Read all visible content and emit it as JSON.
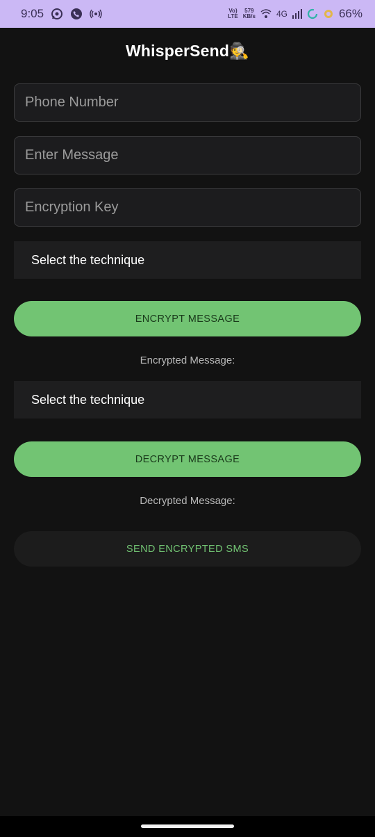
{
  "status_bar": {
    "time": "9:05",
    "network_type": "4G",
    "speed_value": "579",
    "speed_unit": "KB/s",
    "volte_top": "Vo)",
    "volte_bottom": "LTE",
    "battery_percent": "66%"
  },
  "app": {
    "title": "WhisperSend🕵️"
  },
  "form": {
    "phone_placeholder": "Phone Number",
    "message_placeholder": "Enter Message",
    "key_placeholder": "Encryption Key",
    "encrypt_technique": "Select the technique",
    "encrypt_button": "ENCRYPT MESSAGE",
    "encrypted_caption": "Encrypted Message:",
    "decrypt_technique": "Select the technique",
    "decrypt_button": "DECRYPT MESSAGE",
    "decrypted_caption": "Decrypted Message:",
    "send_button": "SEND ENCRYPTED SMS"
  },
  "colors": {
    "background": "#121212",
    "status_bar": "#cbb8f5",
    "accent_green": "#72c473"
  }
}
